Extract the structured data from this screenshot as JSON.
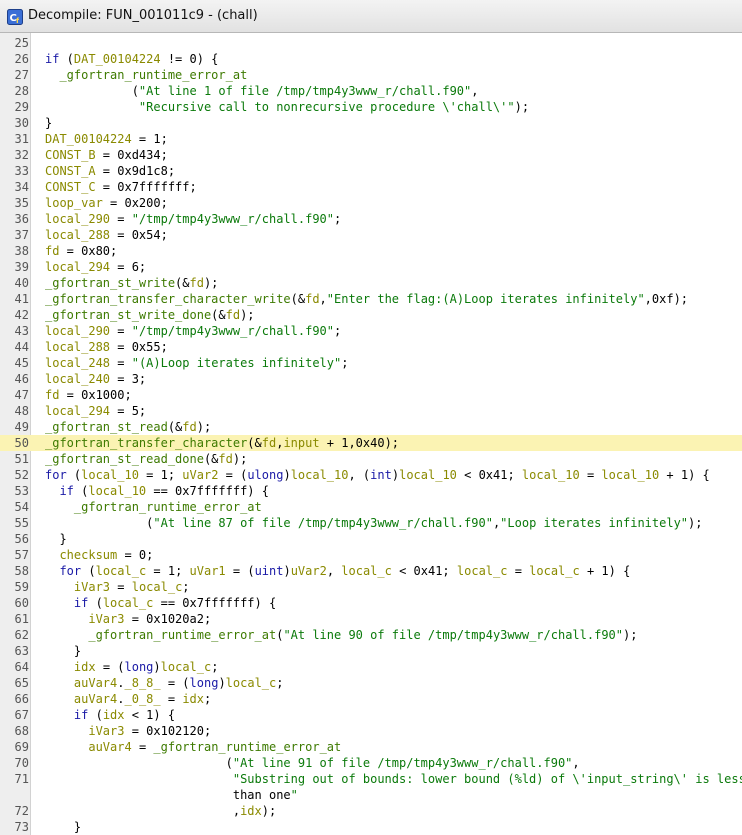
{
  "window": {
    "title": "Decompile: FUN_001011c9 - (chall)",
    "icon": "ghidra-decompiler-icon"
  },
  "highlight_line": "50",
  "colors": {
    "highlight": "#fbf3b3",
    "keyword": "#1a1aa6",
    "function": "#3d7a00",
    "variable": "#8a8a00",
    "string": "#0b7a0b"
  },
  "lines": [
    {
      "n": "25",
      "code": ""
    },
    {
      "n": "26",
      "code": "if (DAT_00104224 != 0) {"
    },
    {
      "n": "27",
      "code": "  _gfortran_runtime_error_at"
    },
    {
      "n": "28",
      "code": "            (\"At line 1 of file /tmp/tmp4y3www_r/chall.f90\","
    },
    {
      "n": "29",
      "code": "             \"Recursive call to nonrecursive procedure \\'chall\\'\");"
    },
    {
      "n": "30",
      "code": "}"
    },
    {
      "n": "31",
      "code": "DAT_00104224 = 1;"
    },
    {
      "n": "32",
      "code": "CONST_B = 0xd434;"
    },
    {
      "n": "33",
      "code": "CONST_A = 0x9d1c8;"
    },
    {
      "n": "34",
      "code": "CONST_C = 0x7fffffff;"
    },
    {
      "n": "35",
      "code": "loop_var = 0x200;"
    },
    {
      "n": "36",
      "code": "local_290 = \"/tmp/tmp4y3www_r/chall.f90\";"
    },
    {
      "n": "37",
      "code": "local_288 = 0x54;"
    },
    {
      "n": "38",
      "code": "fd = 0x80;"
    },
    {
      "n": "39",
      "code": "local_294 = 6;"
    },
    {
      "n": "40",
      "code": "_gfortran_st_write(&fd);"
    },
    {
      "n": "41",
      "code": "_gfortran_transfer_character_write(&fd,\"Enter the flag:(A)Loop iterates infinitely\",0xf);"
    },
    {
      "n": "42",
      "code": "_gfortran_st_write_done(&fd);"
    },
    {
      "n": "43",
      "code": "local_290 = \"/tmp/tmp4y3www_r/chall.f90\";"
    },
    {
      "n": "44",
      "code": "local_288 = 0x55;"
    },
    {
      "n": "45",
      "code": "local_248 = \"(A)Loop iterates infinitely\";"
    },
    {
      "n": "46",
      "code": "local_240 = 3;"
    },
    {
      "n": "47",
      "code": "fd = 0x1000;"
    },
    {
      "n": "48",
      "code": "local_294 = 5;"
    },
    {
      "n": "49",
      "code": "_gfortran_st_read(&fd);"
    },
    {
      "n": "50",
      "code": "_gfortran_transfer_character(&fd,input + 1,0x40);"
    },
    {
      "n": "51",
      "code": "_gfortran_st_read_done(&fd);"
    },
    {
      "n": "52",
      "code": "for (local_10 = 1; uVar2 = (ulong)local_10, (int)local_10 < 0x41; local_10 = local_10 + 1) {"
    },
    {
      "n": "53",
      "code": "  if (local_10 == 0x7fffffff) {"
    },
    {
      "n": "54",
      "code": "    _gfortran_runtime_error_at"
    },
    {
      "n": "55",
      "code": "              (\"At line 87 of file /tmp/tmp4y3www_r/chall.f90\",\"Loop iterates infinitely\");"
    },
    {
      "n": "56",
      "code": "  }"
    },
    {
      "n": "57",
      "code": "  checksum = 0;"
    },
    {
      "n": "58",
      "code": "  for (local_c = 1; uVar1 = (uint)uVar2, local_c < 0x41; local_c = local_c + 1) {"
    },
    {
      "n": "59",
      "code": "    iVar3 = local_c;"
    },
    {
      "n": "60",
      "code": "    if (local_c == 0x7fffffff) {"
    },
    {
      "n": "61",
      "code": "      iVar3 = 0x1020a2;"
    },
    {
      "n": "62",
      "code": "      _gfortran_runtime_error_at(\"At line 90 of file /tmp/tmp4y3www_r/chall.f90\");"
    },
    {
      "n": "63",
      "code": "    }"
    },
    {
      "n": "64",
      "code": "    idx = (long)local_c;"
    },
    {
      "n": "65",
      "code": "    auVar4._8_8_ = (long)local_c;"
    },
    {
      "n": "66",
      "code": "    auVar4._0_8_ = idx;"
    },
    {
      "n": "67",
      "code": "    if (idx < 1) {"
    },
    {
      "n": "68",
      "code": "      iVar3 = 0x102120;"
    },
    {
      "n": "69",
      "code": "      auVar4 = _gfortran_runtime_error_at"
    },
    {
      "n": "70",
      "code": "                         (\"At line 91 of file /tmp/tmp4y3www_r/chall.f90\","
    },
    {
      "n": "71",
      "code": "                          \"Substring out of bounds: lower bound (%ld) of \\'input_string\\' is less"
    },
    {
      "n": "",
      "code": "                          than one\""
    },
    {
      "n": "72",
      "code": "                          ,idx);"
    },
    {
      "n": "73",
      "code": "    }"
    }
  ]
}
